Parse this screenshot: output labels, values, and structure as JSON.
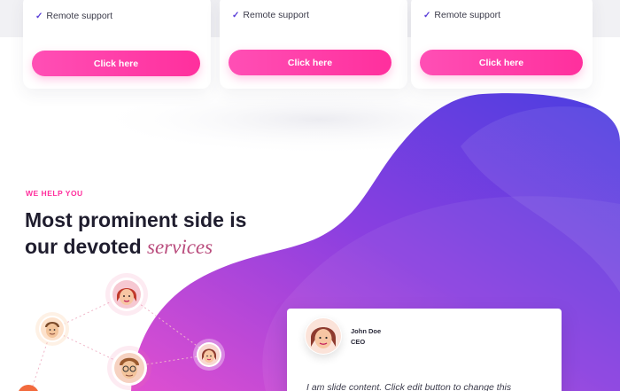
{
  "pricing_cards": [
    {
      "feature": "Remote support",
      "button_label": "Click here"
    },
    {
      "feature": "Remote support",
      "button_label": "Click here"
    },
    {
      "feature": "Remote support",
      "button_label": "Click here"
    }
  ],
  "section": {
    "eyebrow": "WE HELP YOU",
    "headline_line1": "Most prominent side is",
    "headline_line2": "our devoted",
    "headline_accent": "services"
  },
  "testimonial": {
    "name": "John Doe",
    "role": "CEO",
    "quote": "I am slide content. Click edit button to change this"
  },
  "colors": {
    "accent_pink": "#ff2f9d",
    "blob_purple": "#7b3fe0",
    "blob_pink": "#e04fd0",
    "headline": "#1f1d2e"
  }
}
